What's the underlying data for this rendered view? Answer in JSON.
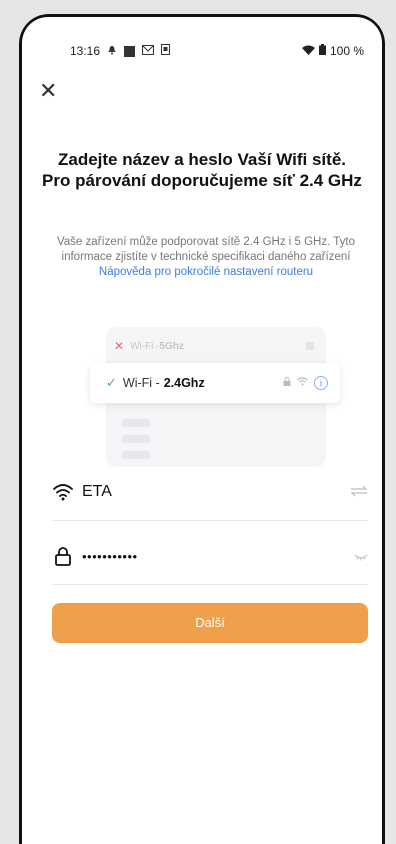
{
  "status_bar": {
    "time": "13:16",
    "battery": "100 %"
  },
  "header": {
    "close_label": "✕"
  },
  "main": {
    "title": "Zadejte název a heslo Vaší Wifi sítě. Pro párování doporučujeme síť 2.4 GHz",
    "description": "Vaše zařízení může podporovat sítě 2.4 GHz i 5 GHz. Tyto informace zjistíte v technické specifikaci daného zařízení ",
    "help_link": "Nápověda pro pokročilé nastavení routeru"
  },
  "illustration": {
    "wifi5_prefix": "Wi-Fi - ",
    "wifi5_band": "5Ghz",
    "wifi24_prefix": "Wi-Fi - ",
    "wifi24_band": "2.4Ghz"
  },
  "form": {
    "ssid_value": "ETA",
    "password_value": "•••••••••••",
    "next_button": "Další"
  },
  "colors": {
    "accent": "#f0a04b",
    "link": "#3b7be8"
  }
}
